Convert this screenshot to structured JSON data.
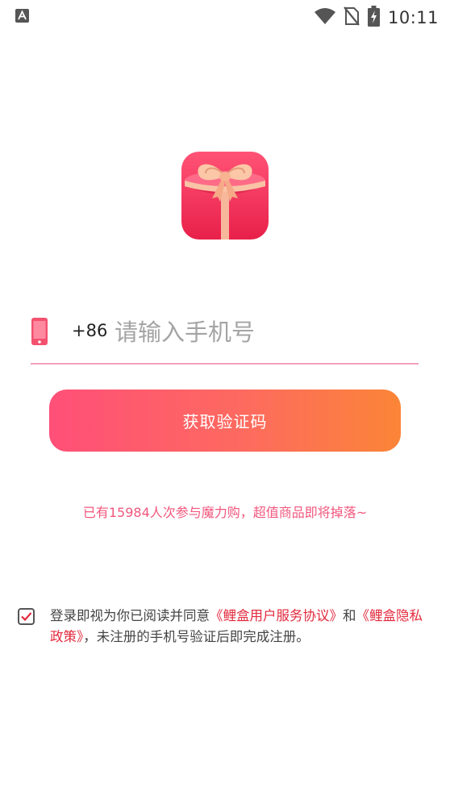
{
  "status_bar": {
    "time": "10:11",
    "icons": [
      "notification-a-icon",
      "wifi-icon",
      "no-sim-icon",
      "battery-charging-icon"
    ]
  },
  "app": {
    "logo": "gift-box-icon",
    "accent_color": "#f1577d",
    "button_gradient": [
      "#ff4f78",
      "#fb8537"
    ]
  },
  "phone": {
    "icon": "smartphone-icon",
    "country_code": "+86",
    "value": "",
    "placeholder": "请输入手机号"
  },
  "get_code_button": {
    "label": "获取验证码"
  },
  "promo": {
    "text": "已有15984人次参与魔力购，超值商品即将掉落~"
  },
  "agreement": {
    "checked": true,
    "prefix": "登录即视为你已阅读并同意",
    "user_agreement_link": "《鲤盒用户服务协议》",
    "conjunction": "和",
    "privacy_link": "《鲤盒隐私政策》",
    "suffix": "，未注册的手机号验证后即完成注册。"
  }
}
